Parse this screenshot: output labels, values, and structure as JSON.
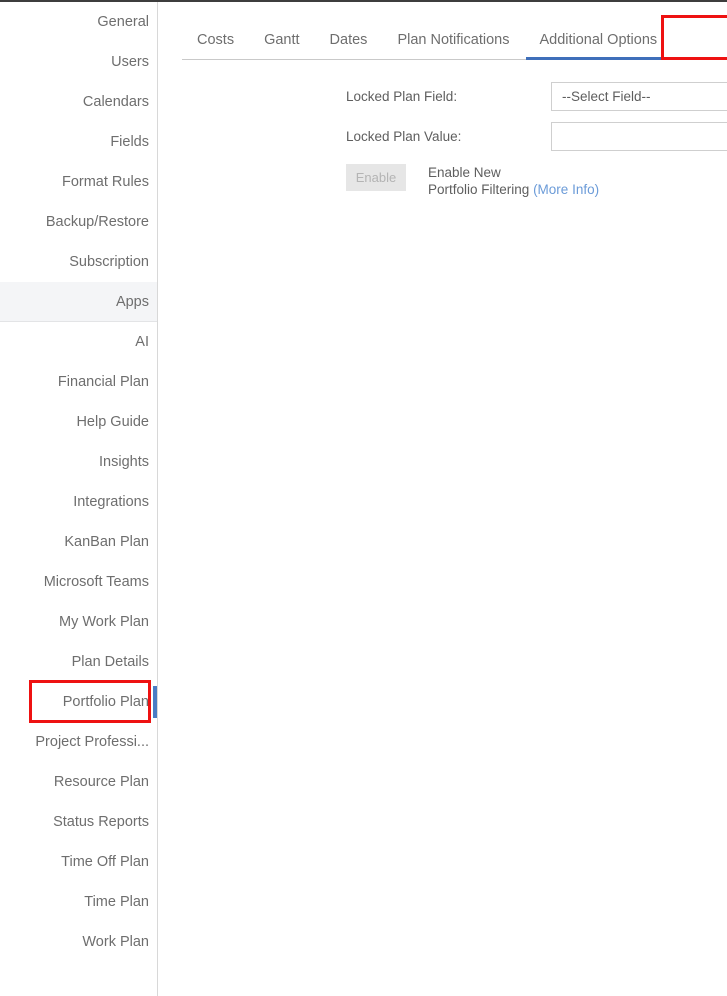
{
  "sidebar": {
    "items": [
      {
        "label": "General",
        "selected": false,
        "accent": false,
        "highlighted": false
      },
      {
        "label": "Users",
        "selected": false,
        "accent": false,
        "highlighted": false
      },
      {
        "label": "Calendars",
        "selected": false,
        "accent": false,
        "highlighted": false
      },
      {
        "label": "Fields",
        "selected": false,
        "accent": false,
        "highlighted": false
      },
      {
        "label": "Format Rules",
        "selected": false,
        "accent": false,
        "highlighted": false
      },
      {
        "label": "Backup/Restore",
        "selected": false,
        "accent": false,
        "highlighted": false
      },
      {
        "label": "Subscription",
        "selected": false,
        "accent": false,
        "highlighted": false
      },
      {
        "label": "Apps",
        "selected": true,
        "accent": false,
        "highlighted": false
      },
      {
        "label": "AI",
        "selected": false,
        "accent": false,
        "highlighted": false
      },
      {
        "label": "Financial Plan",
        "selected": false,
        "accent": false,
        "highlighted": false
      },
      {
        "label": "Help Guide",
        "selected": false,
        "accent": false,
        "highlighted": false
      },
      {
        "label": "Insights",
        "selected": false,
        "accent": false,
        "highlighted": false
      },
      {
        "label": "Integrations",
        "selected": false,
        "accent": false,
        "highlighted": false
      },
      {
        "label": "KanBan Plan",
        "selected": false,
        "accent": false,
        "highlighted": false
      },
      {
        "label": "Microsoft Teams",
        "selected": false,
        "accent": false,
        "highlighted": false
      },
      {
        "label": "My Work Plan",
        "selected": false,
        "accent": false,
        "highlighted": false
      },
      {
        "label": "Plan Details",
        "selected": false,
        "accent": false,
        "highlighted": false
      },
      {
        "label": "Portfolio Plan",
        "selected": false,
        "accent": true,
        "highlighted": true
      },
      {
        "label": "Project Professi...",
        "selected": false,
        "accent": false,
        "highlighted": false
      },
      {
        "label": "Resource Plan",
        "selected": false,
        "accent": false,
        "highlighted": false
      },
      {
        "label": "Status Reports",
        "selected": false,
        "accent": false,
        "highlighted": false
      },
      {
        "label": "Time Off Plan",
        "selected": false,
        "accent": false,
        "highlighted": false
      },
      {
        "label": "Time Plan",
        "selected": false,
        "accent": false,
        "highlighted": false
      },
      {
        "label": "Work Plan",
        "selected": false,
        "accent": false,
        "highlighted": false
      }
    ]
  },
  "tabs": [
    {
      "label": "Costs",
      "active": false
    },
    {
      "label": "Gantt",
      "active": false
    },
    {
      "label": "Dates",
      "active": false
    },
    {
      "label": "Plan Notifications",
      "active": false
    },
    {
      "label": "Additional Options",
      "active": true
    }
  ],
  "form": {
    "locked_plan_field_label": "Locked Plan Field:",
    "locked_plan_field_value": "--Select Field--",
    "locked_plan_value_label": "Locked Plan Value:",
    "locked_plan_value_value": "",
    "locked_plan_value_placeholder": "",
    "enable_button_label": "Enable",
    "enable_text_line1": "Enable New",
    "enable_text_line2": "Portfolio Filtering",
    "more_info_label": "(More Info)"
  },
  "colors": {
    "accent_blue": "#3f6fba",
    "sidebar_accent": "#4a7cc4",
    "annotation_red": "#ee1111",
    "link_blue": "#6b9bd8",
    "text_gray": "#5e5e5e",
    "selected_row_bg": "#f4f5f7"
  }
}
